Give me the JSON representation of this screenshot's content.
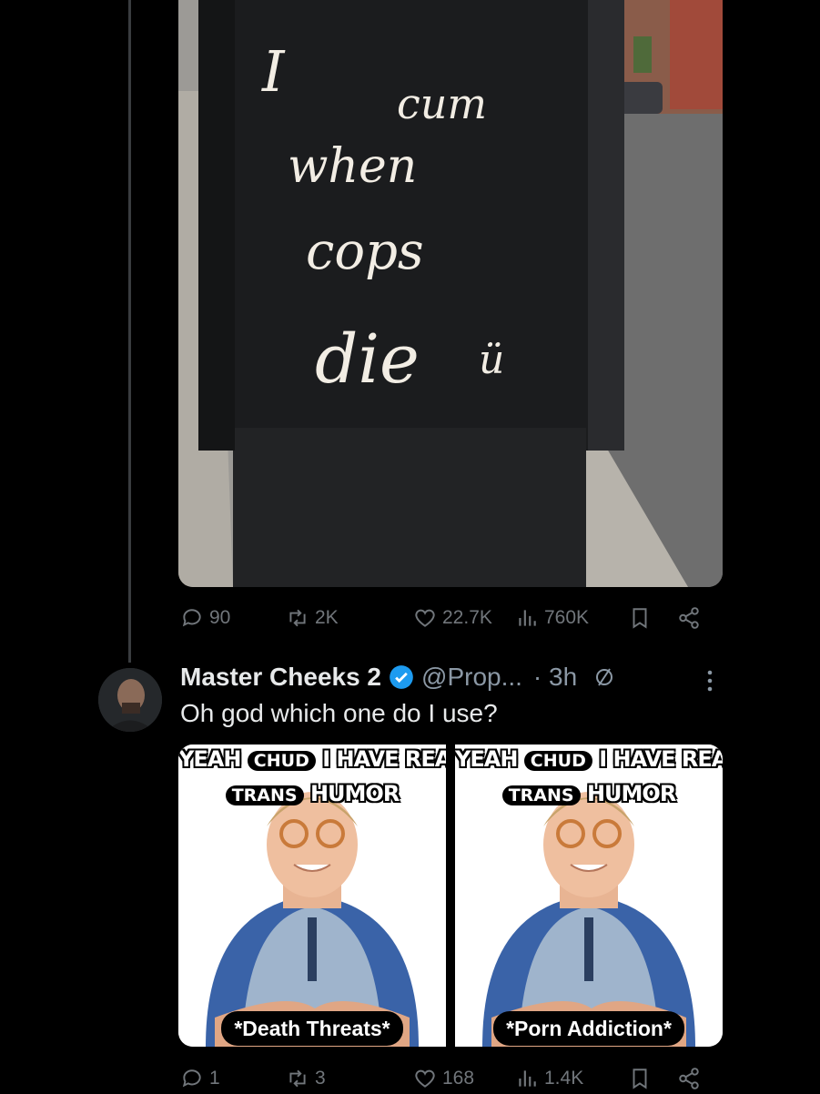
{
  "tweet1": {
    "graffiti": [
      "I",
      "cum",
      "when",
      "cops",
      "die"
    ],
    "graffiti_emoticon": "ü",
    "stats": {
      "replies": "90",
      "reposts": "2K",
      "likes": "22.7K",
      "views": "760K"
    }
  },
  "reply": {
    "display_name": "Master Cheeks 2",
    "handle": "@Prop...",
    "time": "· 3h",
    "text": "Oh god which one do I use?",
    "media": [
      {
        "top_prefix": "YEAH",
        "chip1": "CHUD",
        "top_suffix": "I HAVE REALLY",
        "chip2": "TRANS",
        "line2": "HUMOR",
        "caption": "*Death Threats*"
      },
      {
        "top_prefix": "YEAH",
        "chip1": "CHUD",
        "top_suffix": "I HAVE REALLY",
        "chip2": "TRANS",
        "line2": "HUMOR",
        "caption": "*Porn Addiction*"
      }
    ],
    "stats": {
      "replies": "1",
      "reposts": "3",
      "likes": "168",
      "views": "1.4K"
    }
  },
  "colors": {
    "background": "#000000",
    "text": "#e7e9ea",
    "muted": "#71767b",
    "verified": "#1d9bf0"
  },
  "icons": [
    "reply-icon",
    "repost-icon",
    "like-icon",
    "views-icon",
    "bookmark-icon",
    "share-icon",
    "verified-badge-icon",
    "grok-icon",
    "more-icon"
  ]
}
